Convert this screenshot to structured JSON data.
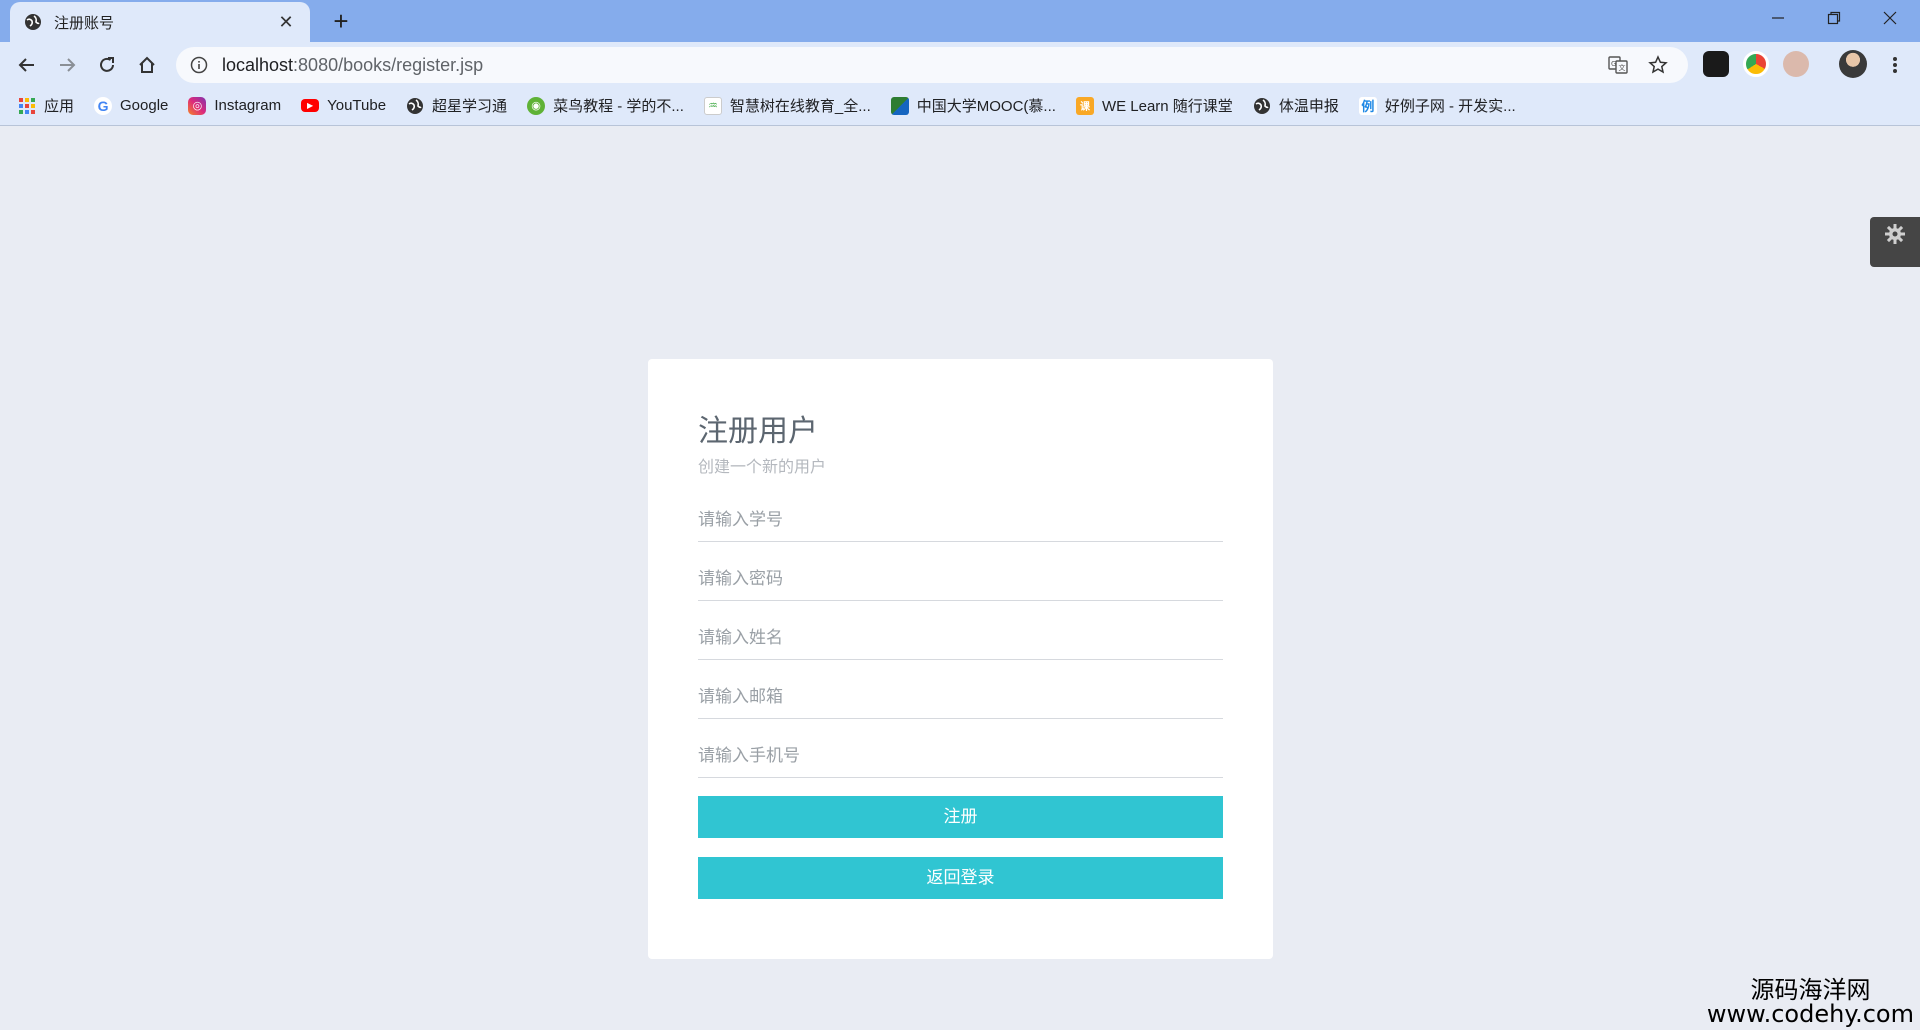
{
  "browser": {
    "tab_title": "注册账号",
    "new_tab_symbol": "+",
    "url_host": "localhost",
    "url_path": ":8080/books/register.jsp",
    "bookmarks": [
      {
        "label": "应用",
        "icon": "apps-grid-icon",
        "color": "#e8453c"
      },
      {
        "label": "Google",
        "icon": "google-icon",
        "color": "#4285f4"
      },
      {
        "label": "Instagram",
        "icon": "instagram-icon",
        "color": "#c13584"
      },
      {
        "label": "YouTube",
        "icon": "youtube-icon",
        "color": "#ff0000"
      },
      {
        "label": "超星学习通",
        "icon": "globe-icon",
        "color": "#333333"
      },
      {
        "label": "菜鸟教程 - 学的不...",
        "icon": "runoob-icon",
        "color": "#5fb236"
      },
      {
        "label": "智慧树在线教育_全...",
        "icon": "zhihuishu-icon",
        "color": "#4caf50"
      },
      {
        "label": "中国大学MOOC(慕...",
        "icon": "mooc-icon",
        "color": "#2e7d32"
      },
      {
        "label": "WE Learn 随行课堂",
        "icon": "welearn-icon",
        "color": "#f9a825"
      },
      {
        "label": "体温申报",
        "icon": "globe-icon",
        "color": "#333333"
      },
      {
        "label": "好例子网 - 开发实...",
        "icon": "haolizi-icon",
        "color": "#1e88e5"
      }
    ]
  },
  "form": {
    "title": "注册用户",
    "subtitle": "创建一个新的用户",
    "fields": {
      "student_id_placeholder": "请输入学号",
      "password_placeholder": "请输入密码",
      "name_placeholder": "请输入姓名",
      "email_placeholder": "请输入邮箱",
      "phone_placeholder": "请输入手机号"
    },
    "register_label": "注册",
    "back_label": "返回登录"
  },
  "watermark": {
    "line1": "源码海洋网",
    "line2": "www.codehy.com"
  },
  "colors": {
    "accent": "#30c5d2",
    "page_bg": "#e9ecf3",
    "chrome_frame": "#85acec"
  }
}
